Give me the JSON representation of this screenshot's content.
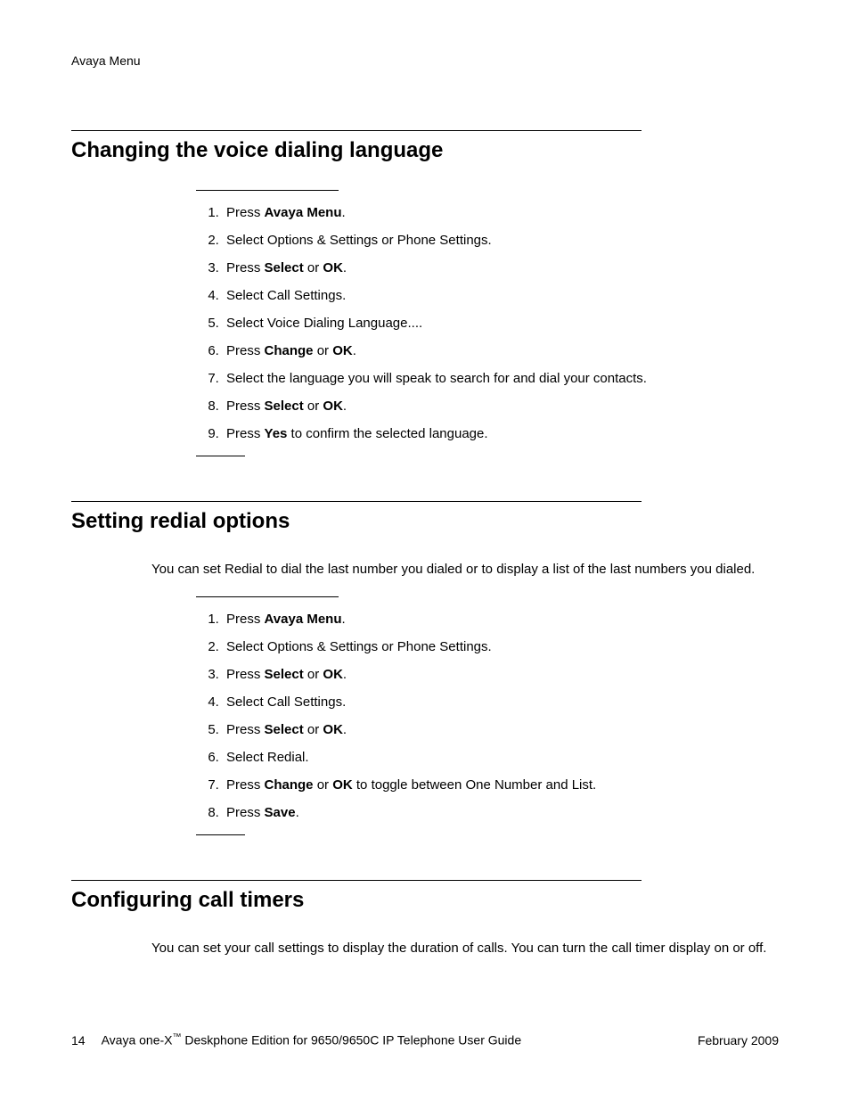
{
  "runningHeader": "Avaya Menu",
  "sections": [
    {
      "title": "Changing the voice dialing language",
      "intro": null,
      "steps": [
        [
          {
            "t": "Press "
          },
          {
            "b": "Avaya Menu"
          },
          {
            "t": "."
          }
        ],
        [
          {
            "t": "Select Options & Settings or Phone Settings."
          }
        ],
        [
          {
            "t": "Press "
          },
          {
            "b": "Select"
          },
          {
            "t": " or "
          },
          {
            "b": "OK"
          },
          {
            "t": "."
          }
        ],
        [
          {
            "t": "Select Call Settings."
          }
        ],
        [
          {
            "t": "Select Voice Dialing Language...."
          }
        ],
        [
          {
            "t": "Press "
          },
          {
            "b": "Change"
          },
          {
            "t": " or "
          },
          {
            "b": "OK"
          },
          {
            "t": "."
          }
        ],
        [
          {
            "t": "Select the language you will speak to search for and dial your contacts."
          }
        ],
        [
          {
            "t": "Press "
          },
          {
            "b": "Select"
          },
          {
            "t": " or "
          },
          {
            "b": "OK"
          },
          {
            "t": "."
          }
        ],
        [
          {
            "t": "Press "
          },
          {
            "b": "Yes"
          },
          {
            "t": " to confirm the selected language."
          }
        ]
      ]
    },
    {
      "title": "Setting redial options",
      "intro": "You can set Redial to dial the last number you dialed or to display a list of the last numbers you dialed.",
      "steps": [
        [
          {
            "t": "Press "
          },
          {
            "b": "Avaya Menu"
          },
          {
            "t": "."
          }
        ],
        [
          {
            "t": "Select Options & Settings or Phone Settings."
          }
        ],
        [
          {
            "t": "Press "
          },
          {
            "b": "Select"
          },
          {
            "t": " or "
          },
          {
            "b": "OK"
          },
          {
            "t": "."
          }
        ],
        [
          {
            "t": "Select Call Settings."
          }
        ],
        [
          {
            "t": "Press "
          },
          {
            "b": "Select"
          },
          {
            "t": " or "
          },
          {
            "b": "OK"
          },
          {
            "t": "."
          }
        ],
        [
          {
            "t": "Select Redial."
          }
        ],
        [
          {
            "t": "Press "
          },
          {
            "b": "Change"
          },
          {
            "t": " or "
          },
          {
            "b": "OK"
          },
          {
            "t": " to toggle between One Number and List."
          }
        ],
        [
          {
            "t": "Press "
          },
          {
            "b": "Save"
          },
          {
            "t": "."
          }
        ]
      ]
    },
    {
      "title": "Configuring call timers",
      "intro": "You can set your call settings to display the duration of calls. You can turn the call timer display on or off.",
      "steps": null
    }
  ],
  "footer": {
    "pageNumber": "14",
    "productPrefix": "Avaya one-X",
    "tm": "™",
    "productSuffix": " Deskphone Edition for 9650/9650C IP Telephone User Guide",
    "date": "February 2009"
  }
}
